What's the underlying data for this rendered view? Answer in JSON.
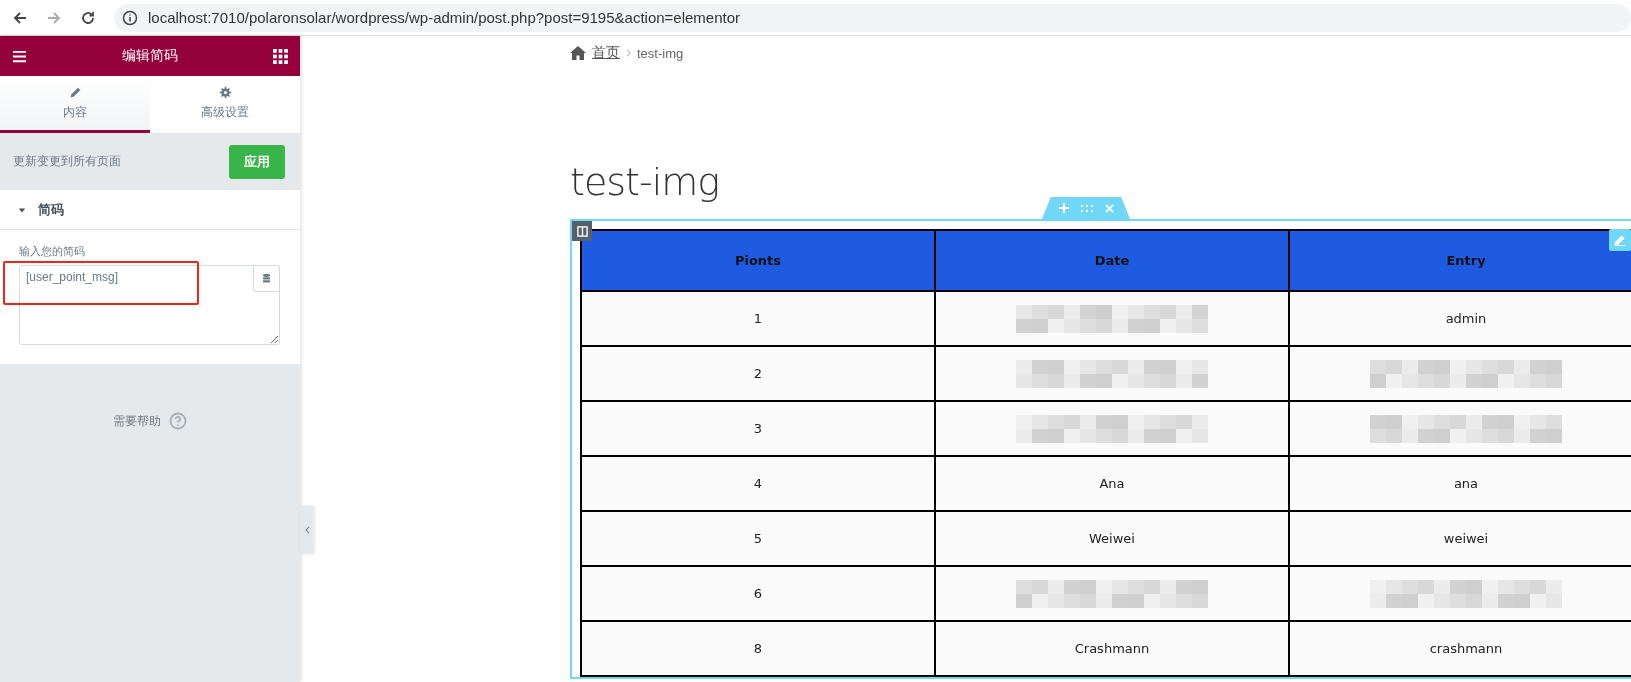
{
  "browser": {
    "url": "localhost:7010/polaronsolar/wordpress/wp-admin/post.php?post=9195&action=elementor"
  },
  "panel": {
    "title": "编辑简码",
    "tabs": [
      {
        "label": "内容",
        "selected": true
      },
      {
        "label": "高级设置",
        "selected": false
      }
    ],
    "apply_text": "更新变更到所有页面",
    "apply_button": "应用",
    "section": {
      "title": "简码",
      "expanded": true,
      "field_label": "输入您的简码",
      "value": "[user_point_msg]"
    },
    "help": "需要帮助"
  },
  "breadcrumb": {
    "home": "首页",
    "current": "test-img"
  },
  "page_title": "test-img",
  "table": {
    "columns": [
      "Pionts",
      "Date",
      "Entry"
    ],
    "rows": [
      {
        "cells": [
          {
            "kind": "text",
            "text": "1"
          },
          {
            "kind": "redacted"
          },
          {
            "kind": "text",
            "text": "admin"
          }
        ]
      },
      {
        "cells": [
          {
            "kind": "text",
            "text": "2"
          },
          {
            "kind": "redacted"
          },
          {
            "kind": "redacted"
          }
        ]
      },
      {
        "cells": [
          {
            "kind": "text",
            "text": "3"
          },
          {
            "kind": "redacted"
          },
          {
            "kind": "redacted"
          }
        ]
      },
      {
        "cells": [
          {
            "kind": "text",
            "text": "4"
          },
          {
            "kind": "text",
            "text": "Ana"
          },
          {
            "kind": "text",
            "text": "ana"
          }
        ]
      },
      {
        "cells": [
          {
            "kind": "text",
            "text": "5"
          },
          {
            "kind": "text",
            "text": "Weiwei"
          },
          {
            "kind": "text",
            "text": "weiwei"
          }
        ]
      },
      {
        "cells": [
          {
            "kind": "text",
            "text": "6"
          },
          {
            "kind": "redacted"
          },
          {
            "kind": "redacted"
          }
        ]
      },
      {
        "cells": [
          {
            "kind": "text",
            "text": "8"
          },
          {
            "kind": "text",
            "text": "Crashmann"
          },
          {
            "kind": "text",
            "text": "crashmann"
          }
        ]
      }
    ]
  }
}
